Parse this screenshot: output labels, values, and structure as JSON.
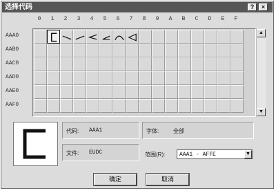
{
  "window": {
    "title": "选择代码",
    "help_label": "?",
    "close_label": "×"
  },
  "columns": [
    "0",
    "1",
    "2",
    "3",
    "4",
    "5",
    "6",
    "7",
    "8",
    "9",
    "A",
    "B",
    "C",
    "D",
    "E",
    "F"
  ],
  "rows": [
    "AAA0",
    "AAB0",
    "AAC0",
    "AAD0",
    "AAE0",
    "AAF0"
  ],
  "glyphs": [
    {
      "row": 0,
      "col": 1,
      "name": "bracket-glyph"
    },
    {
      "row": 0,
      "col": 2,
      "name": "diagonal-down-glyph"
    },
    {
      "row": 0,
      "col": 3,
      "name": "diagonal-up-glyph"
    },
    {
      "row": 0,
      "col": 4,
      "name": "angle-left-glyph"
    },
    {
      "row": 0,
      "col": 5,
      "name": "angle-right-glyph"
    },
    {
      "row": 0,
      "col": 6,
      "name": "arc-glyph"
    },
    {
      "row": 0,
      "col": 7,
      "name": "triangle-left-glyph"
    }
  ],
  "selected": {
    "row": 0,
    "col": 1
  },
  "info": {
    "code_label": "代码:",
    "code_value": "AAA1",
    "font_label": "字体:",
    "font_value": "全部",
    "file_label": "文件:",
    "file_value": "EUDC",
    "range_label": "范围(R):",
    "range_value": "AAA1 - AFFE"
  },
  "buttons": {
    "ok": "确定",
    "cancel": "取消"
  },
  "scrollbar": {
    "up_icon": "▲",
    "down_icon": "▼"
  },
  "dropdown_icon": "▼"
}
